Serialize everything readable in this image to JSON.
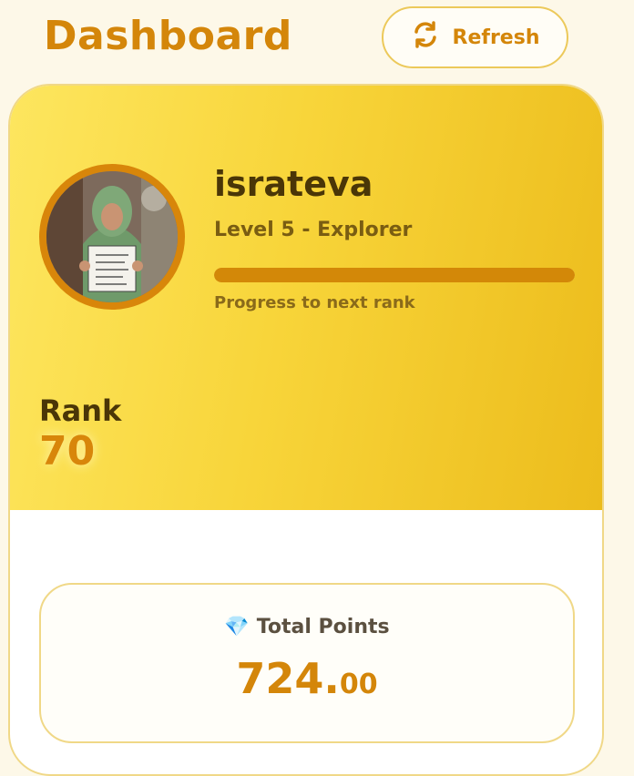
{
  "header": {
    "title": "Dashboard",
    "refresh_label": "Refresh",
    "refresh_icon": "refresh-icon"
  },
  "profile": {
    "username": "israteva",
    "level": "Level 5 - Explorer",
    "progress": 1.0,
    "progress_caption": "Progress to next rank",
    "rank_label": "Rank",
    "rank_value": "70"
  },
  "points": {
    "icon": "gem-icon",
    "label": "Total Points",
    "value_int": "724.",
    "value_dec": "00"
  },
  "colors": {
    "accent": "#d4860a",
    "hero_start": "#fde65f",
    "hero_end": "#ecbc1c",
    "text_dark": "#4a3607"
  }
}
